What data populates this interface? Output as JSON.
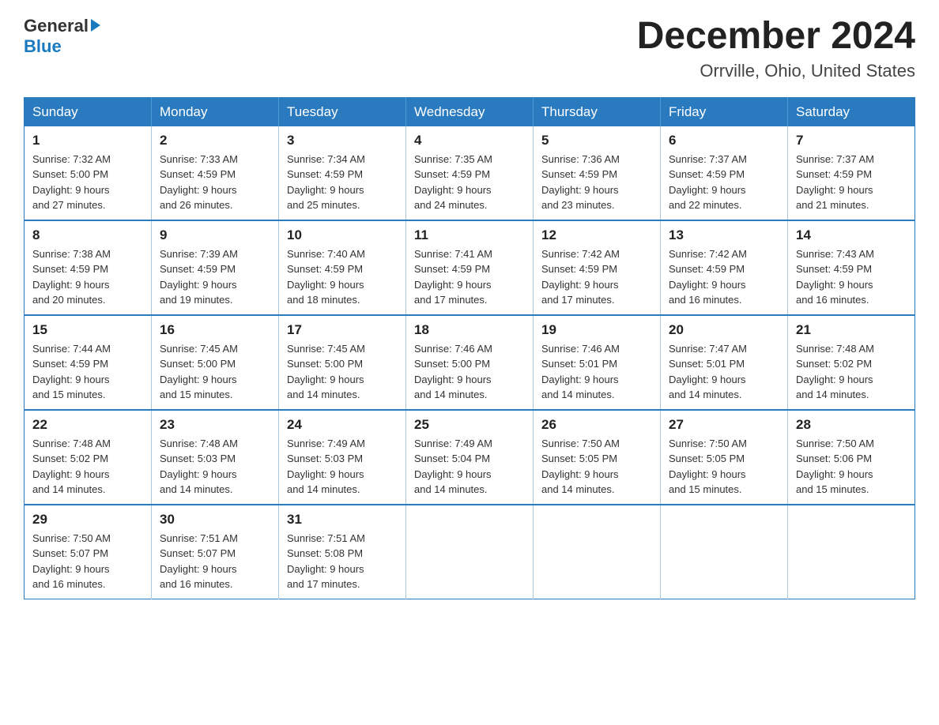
{
  "logo": {
    "general": "General",
    "arrow": "▶",
    "blue": "Blue"
  },
  "title": "December 2024",
  "location": "Orrville, Ohio, United States",
  "days_of_week": [
    "Sunday",
    "Monday",
    "Tuesday",
    "Wednesday",
    "Thursday",
    "Friday",
    "Saturday"
  ],
  "weeks": [
    [
      {
        "day": "1",
        "sunrise": "7:32 AM",
        "sunset": "5:00 PM",
        "daylight": "9 hours and 27 minutes."
      },
      {
        "day": "2",
        "sunrise": "7:33 AM",
        "sunset": "4:59 PM",
        "daylight": "9 hours and 26 minutes."
      },
      {
        "day": "3",
        "sunrise": "7:34 AM",
        "sunset": "4:59 PM",
        "daylight": "9 hours and 25 minutes."
      },
      {
        "day": "4",
        "sunrise": "7:35 AM",
        "sunset": "4:59 PM",
        "daylight": "9 hours and 24 minutes."
      },
      {
        "day": "5",
        "sunrise": "7:36 AM",
        "sunset": "4:59 PM",
        "daylight": "9 hours and 23 minutes."
      },
      {
        "day": "6",
        "sunrise": "7:37 AM",
        "sunset": "4:59 PM",
        "daylight": "9 hours and 22 minutes."
      },
      {
        "day": "7",
        "sunrise": "7:37 AM",
        "sunset": "4:59 PM",
        "daylight": "9 hours and 21 minutes."
      }
    ],
    [
      {
        "day": "8",
        "sunrise": "7:38 AM",
        "sunset": "4:59 PM",
        "daylight": "9 hours and 20 minutes."
      },
      {
        "day": "9",
        "sunrise": "7:39 AM",
        "sunset": "4:59 PM",
        "daylight": "9 hours and 19 minutes."
      },
      {
        "day": "10",
        "sunrise": "7:40 AM",
        "sunset": "4:59 PM",
        "daylight": "9 hours and 18 minutes."
      },
      {
        "day": "11",
        "sunrise": "7:41 AM",
        "sunset": "4:59 PM",
        "daylight": "9 hours and 17 minutes."
      },
      {
        "day": "12",
        "sunrise": "7:42 AM",
        "sunset": "4:59 PM",
        "daylight": "9 hours and 17 minutes."
      },
      {
        "day": "13",
        "sunrise": "7:42 AM",
        "sunset": "4:59 PM",
        "daylight": "9 hours and 16 minutes."
      },
      {
        "day": "14",
        "sunrise": "7:43 AM",
        "sunset": "4:59 PM",
        "daylight": "9 hours and 16 minutes."
      }
    ],
    [
      {
        "day": "15",
        "sunrise": "7:44 AM",
        "sunset": "4:59 PM",
        "daylight": "9 hours and 15 minutes."
      },
      {
        "day": "16",
        "sunrise": "7:45 AM",
        "sunset": "5:00 PM",
        "daylight": "9 hours and 15 minutes."
      },
      {
        "day": "17",
        "sunrise": "7:45 AM",
        "sunset": "5:00 PM",
        "daylight": "9 hours and 14 minutes."
      },
      {
        "day": "18",
        "sunrise": "7:46 AM",
        "sunset": "5:00 PM",
        "daylight": "9 hours and 14 minutes."
      },
      {
        "day": "19",
        "sunrise": "7:46 AM",
        "sunset": "5:01 PM",
        "daylight": "9 hours and 14 minutes."
      },
      {
        "day": "20",
        "sunrise": "7:47 AM",
        "sunset": "5:01 PM",
        "daylight": "9 hours and 14 minutes."
      },
      {
        "day": "21",
        "sunrise": "7:48 AM",
        "sunset": "5:02 PM",
        "daylight": "9 hours and 14 minutes."
      }
    ],
    [
      {
        "day": "22",
        "sunrise": "7:48 AM",
        "sunset": "5:02 PM",
        "daylight": "9 hours and 14 minutes."
      },
      {
        "day": "23",
        "sunrise": "7:48 AM",
        "sunset": "5:03 PM",
        "daylight": "9 hours and 14 minutes."
      },
      {
        "day": "24",
        "sunrise": "7:49 AM",
        "sunset": "5:03 PM",
        "daylight": "9 hours and 14 minutes."
      },
      {
        "day": "25",
        "sunrise": "7:49 AM",
        "sunset": "5:04 PM",
        "daylight": "9 hours and 14 minutes."
      },
      {
        "day": "26",
        "sunrise": "7:50 AM",
        "sunset": "5:05 PM",
        "daylight": "9 hours and 14 minutes."
      },
      {
        "day": "27",
        "sunrise": "7:50 AM",
        "sunset": "5:05 PM",
        "daylight": "9 hours and 15 minutes."
      },
      {
        "day": "28",
        "sunrise": "7:50 AM",
        "sunset": "5:06 PM",
        "daylight": "9 hours and 15 minutes."
      }
    ],
    [
      {
        "day": "29",
        "sunrise": "7:50 AM",
        "sunset": "5:07 PM",
        "daylight": "9 hours and 16 minutes."
      },
      {
        "day": "30",
        "sunrise": "7:51 AM",
        "sunset": "5:07 PM",
        "daylight": "9 hours and 16 minutes."
      },
      {
        "day": "31",
        "sunrise": "7:51 AM",
        "sunset": "5:08 PM",
        "daylight": "9 hours and 17 minutes."
      },
      null,
      null,
      null,
      null
    ]
  ],
  "labels": {
    "sunrise": "Sunrise:",
    "sunset": "Sunset:",
    "daylight": "Daylight:"
  }
}
